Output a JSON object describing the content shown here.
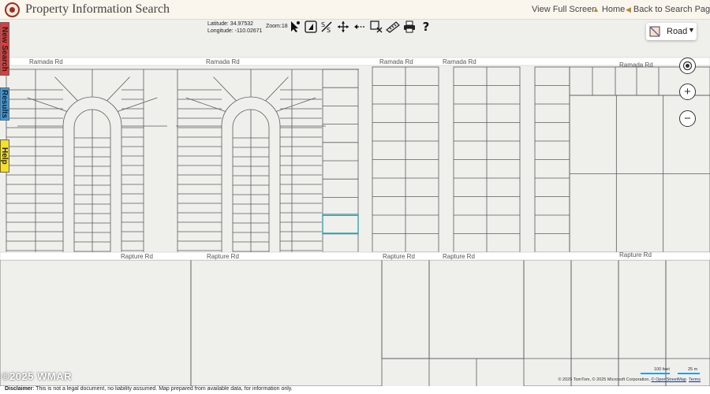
{
  "header": {
    "title": "Property Information Search",
    "links": {
      "view_full_screen": "View Full Screen",
      "home": "Home",
      "back": "Back to Search Page"
    }
  },
  "side_tabs": {
    "new_search": "New Search",
    "results": "Results",
    "help": "Help"
  },
  "location": {
    "latitude": "Latitude: 34.97532",
    "longitude": "Longitude: -110.02671",
    "zoom": "Zoom:18"
  },
  "tools": [
    "select-icon",
    "identify-icon",
    "measure-icon",
    "pan-icon",
    "previous-extent-icon",
    "clear-selection-icon",
    "ruler-icon",
    "print-icon",
    "help-icon"
  ],
  "basemap": {
    "selected": "Road"
  },
  "roads": {
    "ramada": [
      "Ramada Rd",
      "Ramada Rd",
      "Ramada Rd",
      "Ramada Rd",
      "Ramada Rd"
    ],
    "rapture": [
      "Rapture Rd",
      "Rapture Rd",
      "Rapture Rd",
      "Rapture Rd",
      "Rapture Rd"
    ]
  },
  "attribution": {
    "copyright": "© 2025 TomTom, © 2025 Microsoft Corporation,",
    "osm": "© OpenStreetMap",
    "terms": "Terms"
  },
  "scale": {
    "feet": "100 feet",
    "meters": "25 m"
  },
  "watermark": "©2025 WMAR",
  "disclaimer": {
    "label": "Disclaimer",
    "text": ": This is not a legal document, no liability assumed. Map prepared from available data, for information only."
  },
  "colors": {
    "parcel_line": "#5c5c5c",
    "road_fill": "#ffffff",
    "highlight": "#2aa9b8",
    "new_search_tab": "#e23b3b",
    "results_tab": "#3b9be0",
    "help_tab": "#f5e02a",
    "map_background": "#efefec"
  }
}
